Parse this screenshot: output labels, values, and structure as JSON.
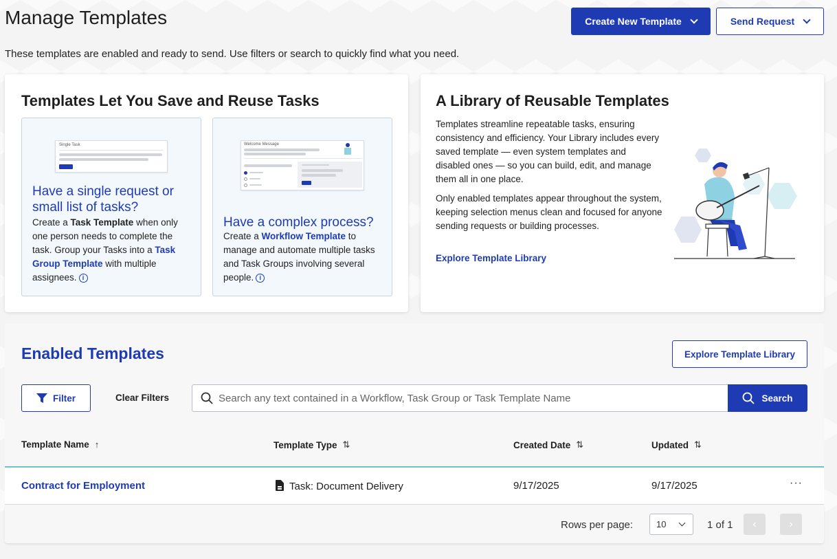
{
  "header": {
    "title": "Manage Templates",
    "subtitle": "These templates are enabled and ready to send. Use filters or search to quickly find what you need.",
    "create_label": "Create New Template",
    "send_label": "Send Request"
  },
  "info_card": {
    "title": "Templates Let You Save and Reuse Tasks",
    "tile1": {
      "mock_title": "Single Task",
      "heading": "Have a single request or small list of tasks?",
      "text_1": "Create a ",
      "link_1": "Task Template",
      "text_2": " when only one person needs to complete the task. Group your Tasks into a ",
      "link_2": "Task Group Template",
      "text_3": " with multiple assignees."
    },
    "tile2": {
      "mock_title": "Welcome Message",
      "heading": "Have a complex process?",
      "text_1": "Create a ",
      "link_1": "Workflow Template",
      "text_2": " to manage and automate multiple tasks and Task Groups involving several people."
    }
  },
  "library_card": {
    "title": "A Library of Reusable Templates",
    "paragraph_1": "Templates streamline repeatable tasks, ensuring consistency and efficiency. Your Library includes every saved template — even system templates and disabled ones — so you can build, edit, and manage them all in one place.",
    "paragraph_2": "Only enabled templates appear throughout the system, keeping selection menus clean and focused for anyone sending requests or building processes.",
    "link": "Explore Template Library"
  },
  "enabled": {
    "title": "Enabled Templates",
    "explore_label": "Explore Template Library",
    "filter_label": "Filter",
    "clear_label": "Clear Filters",
    "search_placeholder": "Search any text contained in a Workflow, Task Group or Task Template Name",
    "search_label": "Search",
    "columns": [
      "Template Name",
      "Template Type",
      "Created Date",
      "Updated"
    ],
    "rows": [
      {
        "name": "Contract for Employment",
        "type": "Task: Document Delivery",
        "created": "9/17/2025",
        "updated": "9/17/2025"
      }
    ],
    "pagination": {
      "rows_per_page_label": "Rows per page:",
      "rows_per_page": "10",
      "page_info": "1 of 1"
    }
  },
  "colors": {
    "primary": "#1f3bb3",
    "row_accent": "#6fc3d0"
  },
  "icons": [
    "chevron-down-icon",
    "info-icon",
    "filter-icon",
    "search-icon",
    "sort-asc-icon",
    "sort-both-icon",
    "document-icon",
    "more-icon",
    "chevron-left-icon",
    "chevron-right-icon"
  ]
}
